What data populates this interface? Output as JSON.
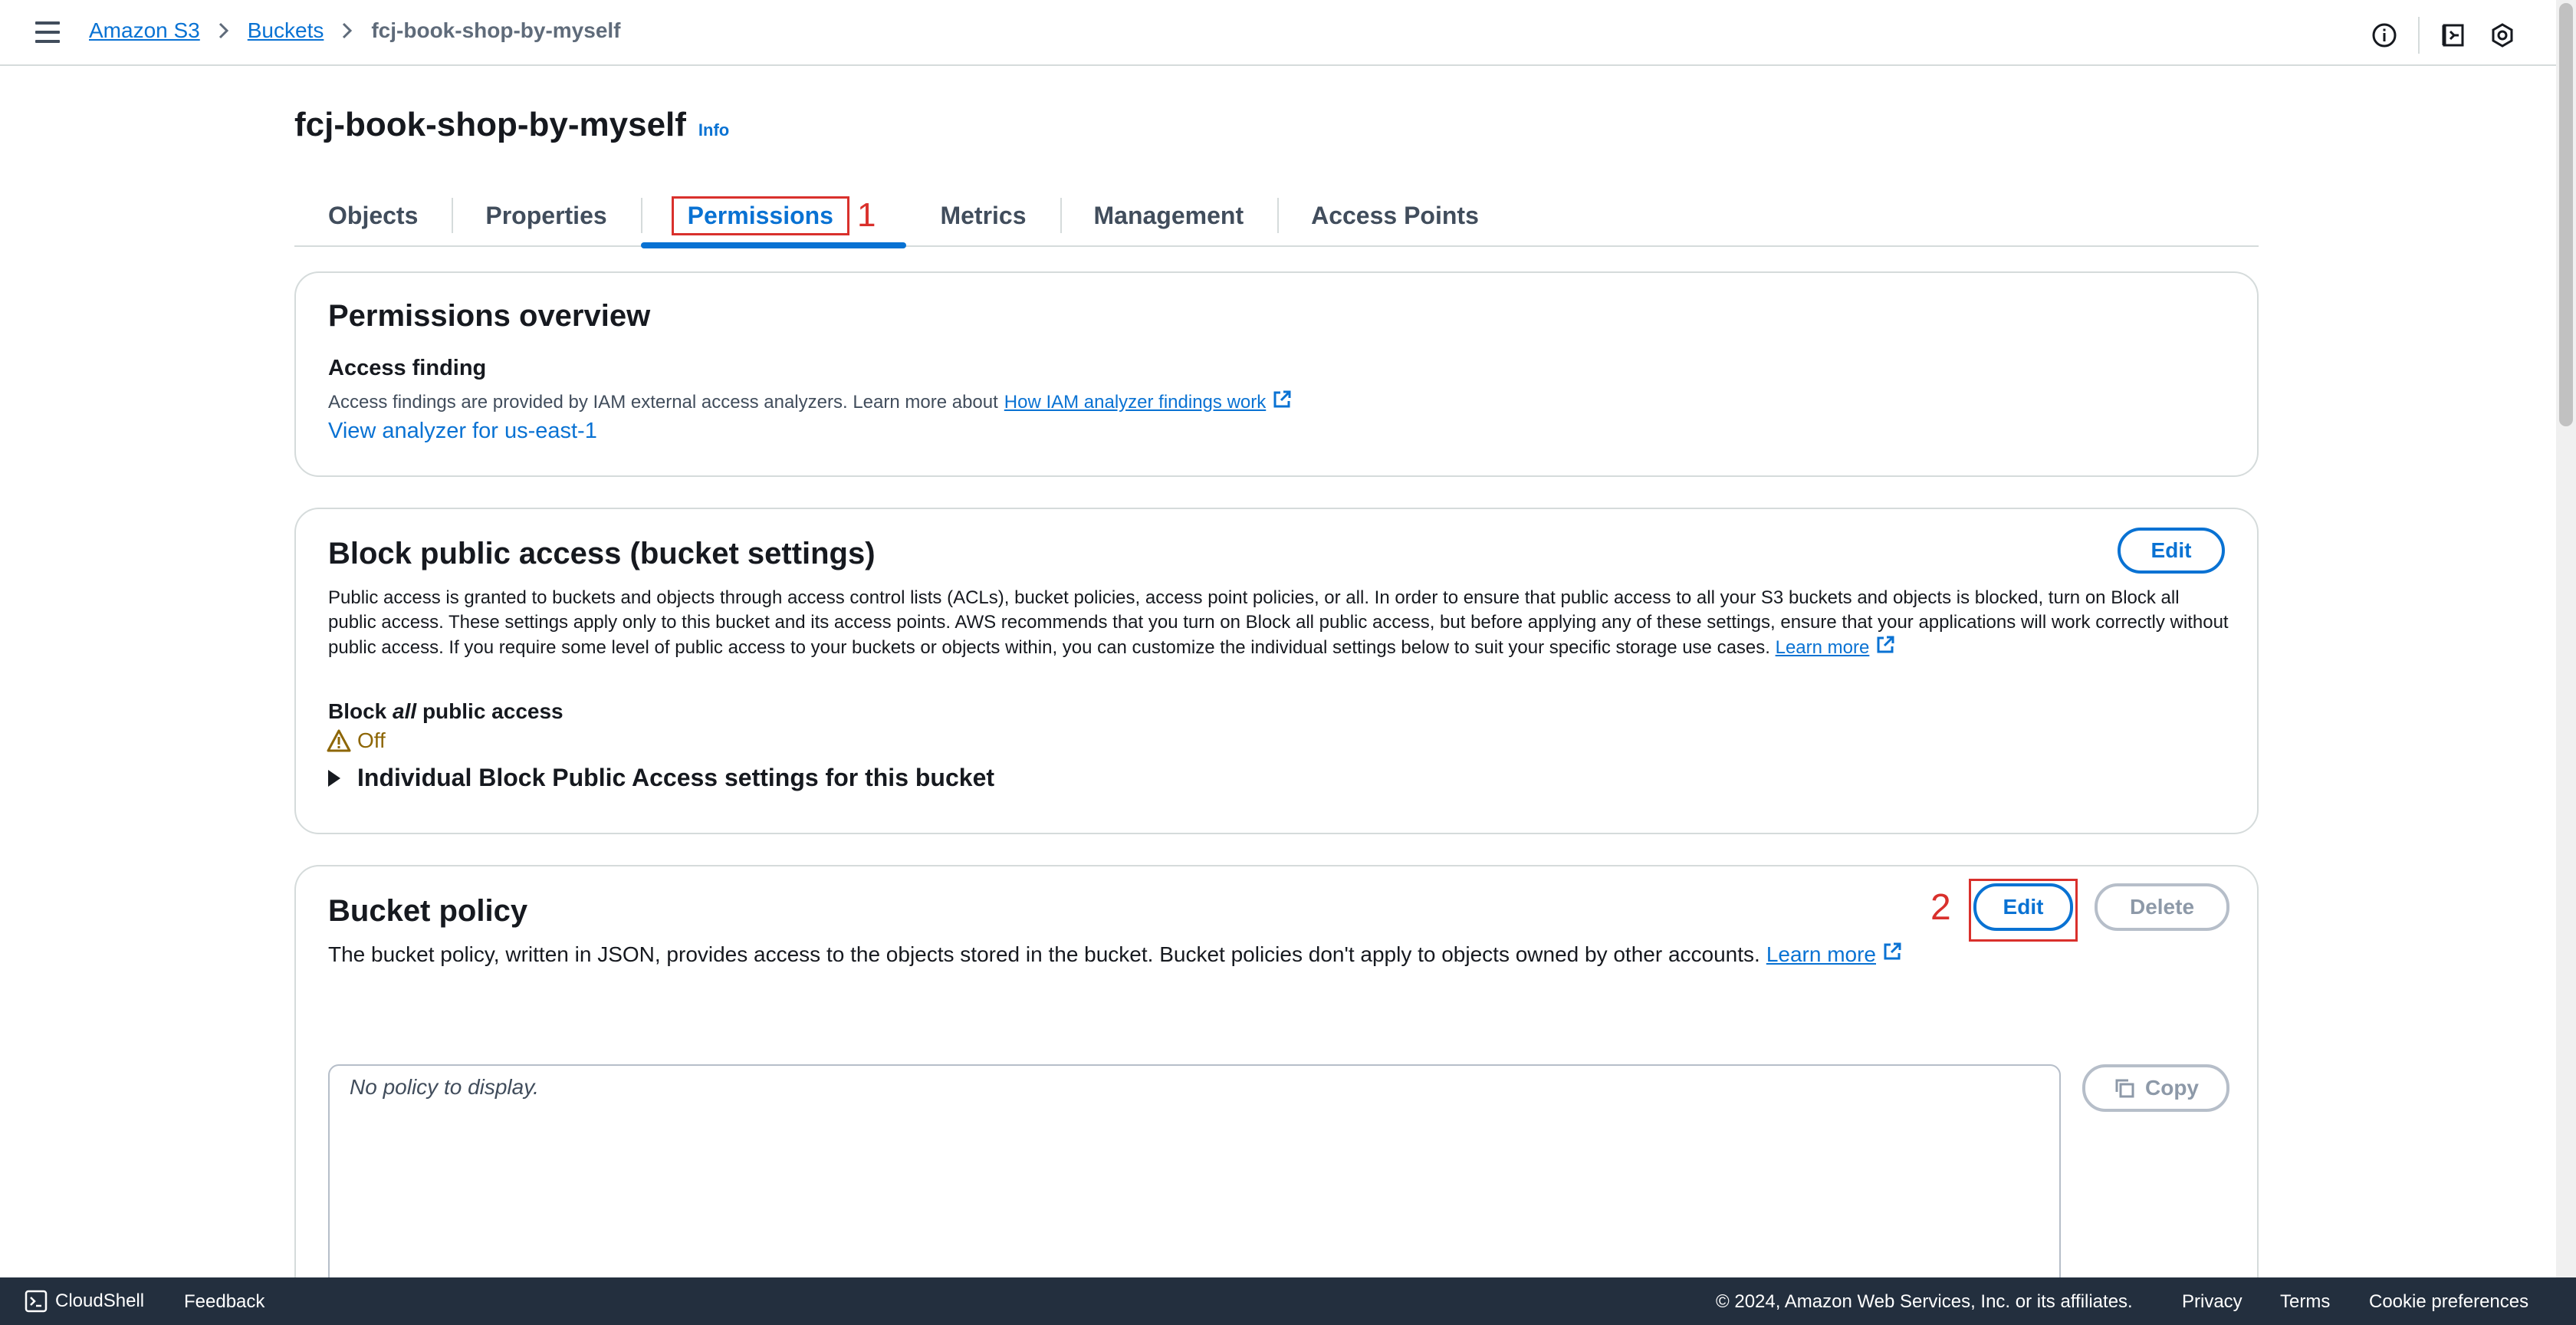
{
  "breadcrumb": {
    "items": [
      "Amazon S3",
      "Buckets"
    ],
    "current": "fcj-book-shop-by-myself"
  },
  "header": {
    "icons": [
      "info-circle-icon",
      "notebook-icon",
      "settings-hexagon-icon"
    ]
  },
  "page": {
    "title": "fcj-book-shop-by-myself",
    "info_label": "Info"
  },
  "tabs": [
    {
      "label": "Objects"
    },
    {
      "label": "Properties"
    },
    {
      "label": "Permissions",
      "marker": "1",
      "active": true
    },
    {
      "label": "Metrics"
    },
    {
      "label": "Management"
    },
    {
      "label": "Access Points"
    }
  ],
  "permissions_overview": {
    "title": "Permissions overview",
    "access_finding_label": "Access finding",
    "description": "Access findings are provided by IAM external access analyzers. Learn more about",
    "link_text": "How IAM analyzer findings work",
    "analyzer_link": "View analyzer for us-east-1"
  },
  "block_public_access": {
    "title": "Block public access (bucket settings)",
    "edit_label": "Edit",
    "description": "Public access is granted to buckets and objects through access control lists (ACLs), bucket policies, access point policies, or all. In order to ensure that public access to all your S3 buckets and objects is blocked, turn on Block all public access. These settings apply only to this bucket and its access points. AWS recommends that you turn on Block all public access, but before applying any of these settings, ensure that your applications will work correctly without public access. If you require some level of public access to your buckets or objects within, you can customize the individual settings below to suit your specific storage use cases.",
    "learn_more": "Learn more",
    "block_all_prefix": "Block ",
    "block_all_italic": "all",
    "block_all_suffix": " public access",
    "status": "Off",
    "status_color": "#8d6605",
    "expander_label": "Individual Block Public Access settings for this bucket"
  },
  "bucket_policy": {
    "title": "Bucket policy",
    "marker": "2",
    "edit_label": "Edit",
    "delete_label": "Delete",
    "description": "The bucket policy, written in JSON, provides access to the objects stored in the bucket. Bucket policies don't apply to objects owned by other accounts.",
    "learn_more": "Learn more",
    "policy_placeholder": "No policy to display.",
    "copy_label": "Copy"
  },
  "footer": {
    "cloudshell": "CloudShell",
    "feedback": "Feedback",
    "copyright": "© 2024, Amazon Web Services, Inc. or its affiliates.",
    "privacy": "Privacy",
    "terms": "Terms",
    "cookie": "Cookie preferences"
  },
  "colors": {
    "accent": "#0972d3",
    "annotation": "#d9302c",
    "footer_bg": "#232f3e"
  }
}
